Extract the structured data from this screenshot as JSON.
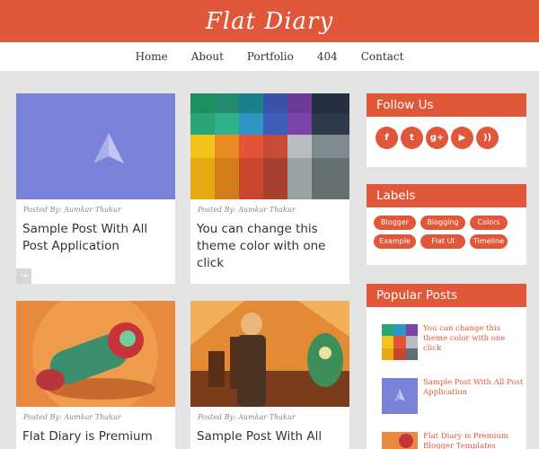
{
  "header": {
    "site_title": "Flat Diary"
  },
  "nav": {
    "items": [
      "Home",
      "About",
      "Portfolio",
      "404",
      "Contact"
    ]
  },
  "posts": [
    {
      "author": "Posted By: Aumkar Thakur",
      "title": "Sample Post With All Post Application"
    },
    {
      "author": "Posted By: Aumkar Thakur",
      "title": "You can change this theme color with one click"
    },
    {
      "author": "Posted By: Aumkar Thakur",
      "title": "Flat Diary is Premium"
    },
    {
      "author": "Posted By: Aumkar Thakur",
      "title": "Sample Post With All"
    }
  ],
  "sidebar": {
    "follow_title": "Follow Us",
    "social_icons": [
      "facebook-icon",
      "twitter-icon",
      "google-plus-icon",
      "youtube-icon",
      "rss-icon"
    ],
    "labels_title": "Labels",
    "labels": [
      "Blogger",
      "Blogging",
      "Colors",
      "Example",
      "Flat UI",
      "Timeline"
    ],
    "popular_title": "Popular Posts",
    "popular": [
      "You can change this theme color with one click",
      "Sample Post With All Post Application",
      "Flat Diary is Premium Blogger Templates"
    ]
  },
  "colors": {
    "accent": "#e15739",
    "background": "#e4e4e4",
    "purple": "#7a81d8"
  }
}
